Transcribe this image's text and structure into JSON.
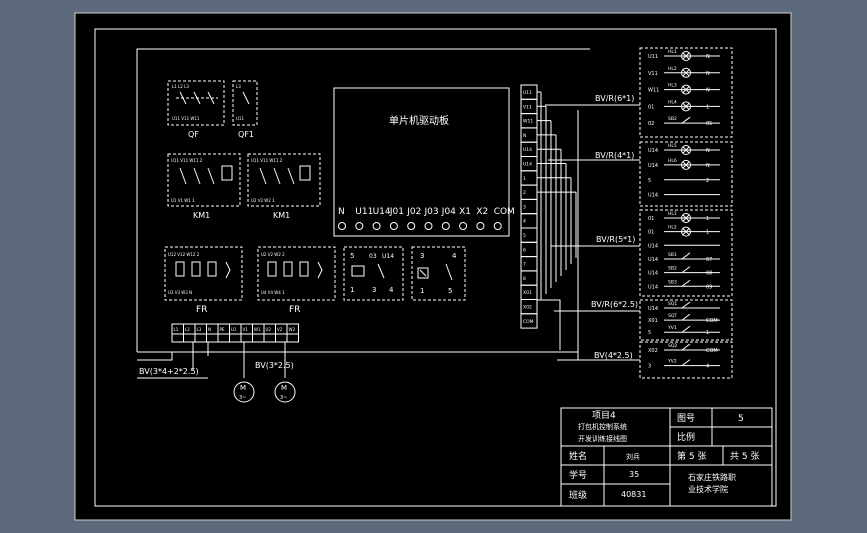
{
  "board": {
    "title": "单片机驱动板",
    "terminals": [
      "N",
      "U11",
      "U14",
      "J01",
      "J02",
      "J03",
      "J04",
      "X1",
      "X2",
      "COM"
    ]
  },
  "breakers": [
    {
      "label": "QF",
      "pins_top": [
        "L1",
        "L2",
        "L3"
      ],
      "pins_bottom": [
        "U11",
        "V11",
        "W11"
      ]
    },
    {
      "label": "QF1",
      "pins_top": [
        "L3"
      ],
      "pins_bottom": [
        "U11"
      ]
    }
  ],
  "contactors": [
    {
      "label": "KM1",
      "pins_top": [
        "U11",
        "V11",
        "W11",
        "2"
      ],
      "pins_bottom": [
        "U1",
        "V1",
        "W1",
        "1"
      ]
    },
    {
      "label": "KM1",
      "pins_top": [
        "U11",
        "V11",
        "W11",
        "2"
      ],
      "pins_bottom": [
        "U2",
        "V2",
        "W2",
        "1"
      ]
    }
  ],
  "relays": [
    {
      "label": "FR",
      "pins_top": [
        "U12",
        "V12",
        "W12",
        "2"
      ],
      "pins_bottom": [
        "U3",
        "V3",
        "W3",
        "N"
      ]
    },
    {
      "label": "FR",
      "pins_top": [
        "U2",
        "V2",
        "W2",
        "2"
      ],
      "pins_bottom": [
        "U4",
        "V4",
        "W4",
        "1"
      ]
    }
  ],
  "small_relays": [
    {
      "pins_top": [
        "5",
        "03",
        "U14"
      ],
      "pins_bottom": [
        "1",
        "3",
        "4"
      ]
    },
    {
      "pins_top": [
        "3",
        "4"
      ],
      "pins_bottom": [
        "1",
        "5"
      ]
    }
  ],
  "bottom_terminals": [
    "L1",
    "L2",
    "L3",
    "N",
    "PE",
    "U1",
    "V1",
    "W1",
    "U2",
    "V2",
    "W2"
  ],
  "terminal_strip": [
    "U11",
    "V11",
    "W11",
    "N",
    "U14",
    "U14",
    "1",
    "2",
    "3",
    "4",
    "5",
    "6",
    "7",
    "8",
    "X01",
    "X02",
    "COM"
  ],
  "cables_left": [
    "BV(3*4+2*2.5)",
    "BV(3*2.5)"
  ],
  "motors": [
    {
      "label": "M",
      "sub": "3~"
    },
    {
      "label": "M",
      "sub": "3~"
    }
  ],
  "cables_right": [
    "BV/R(6*1)",
    "BV/R(4*1)",
    "BV/R(5*1)",
    "BV/R(6*2.5)",
    "BV(4*2.5)"
  ],
  "right_panels": [
    {
      "rows": [
        {
          "pin": "U11",
          "name": "HL1",
          "end": "N"
        },
        {
          "pin": "V11",
          "name": "HL2",
          "end": "N"
        },
        {
          "pin": "W11",
          "name": "HL3",
          "end": "N"
        },
        {
          "pin": "01",
          "name": "HL4",
          "end": "1"
        },
        {
          "pin": "02",
          "name": "SB2",
          "end": "05"
        }
      ]
    },
    {
      "rows": [
        {
          "pin": "U14",
          "name": "HL5",
          "end": "N"
        },
        {
          "pin": "U14",
          "name": "HL6",
          "end": "N"
        },
        {
          "pin": "5",
          "name": "",
          "end": "2"
        },
        {
          "pin": "U14",
          "name": "",
          "end": ""
        }
      ]
    },
    {
      "rows": [
        {
          "pin": "01",
          "name": "HL1",
          "end": "1"
        },
        {
          "pin": "01",
          "name": "HL2",
          "end": "1"
        },
        {
          "pin": "U14",
          "name": "",
          "end": ""
        },
        {
          "pin": "U14",
          "name": "SB1",
          "end": "07"
        },
        {
          "pin": "U14",
          "name": "SB2",
          "end": "08"
        },
        {
          "pin": "U14",
          "name": "SB3",
          "end": "09"
        }
      ]
    },
    {
      "rows": [
        {
          "pin": "U14",
          "name": "SQ1",
          "end": ""
        },
        {
          "pin": "X01",
          "name": "SQT",
          "end": "COM"
        },
        {
          "pin": "5",
          "name": "YV1",
          "end": "1"
        }
      ]
    },
    {
      "rows": [
        {
          "pin": "X02",
          "name": "SQ2",
          "end": "COM"
        },
        {
          "pin": "3",
          "name": "YV2",
          "end": "4"
        }
      ]
    }
  ],
  "title_block": {
    "project": "项目4",
    "subtitle_1": "打包机控制系统",
    "subtitle_2": "开发训练接线图",
    "drawing_no_label": "图号",
    "drawing_no": "5",
    "scale_label": "比例",
    "scale": "",
    "name_label": "姓名",
    "name": "刘兵",
    "sheet": "第 5 张",
    "total": "共 5 张",
    "student_no_label": "学号",
    "student_no": "35",
    "class_label": "班级",
    "class": "40831",
    "school_1": "石家庄铁路职",
    "school_2": "业技术学院"
  },
  "colors": {
    "background": "#5c6a7c",
    "sheet": "#000000",
    "line": "#ffffff"
  }
}
